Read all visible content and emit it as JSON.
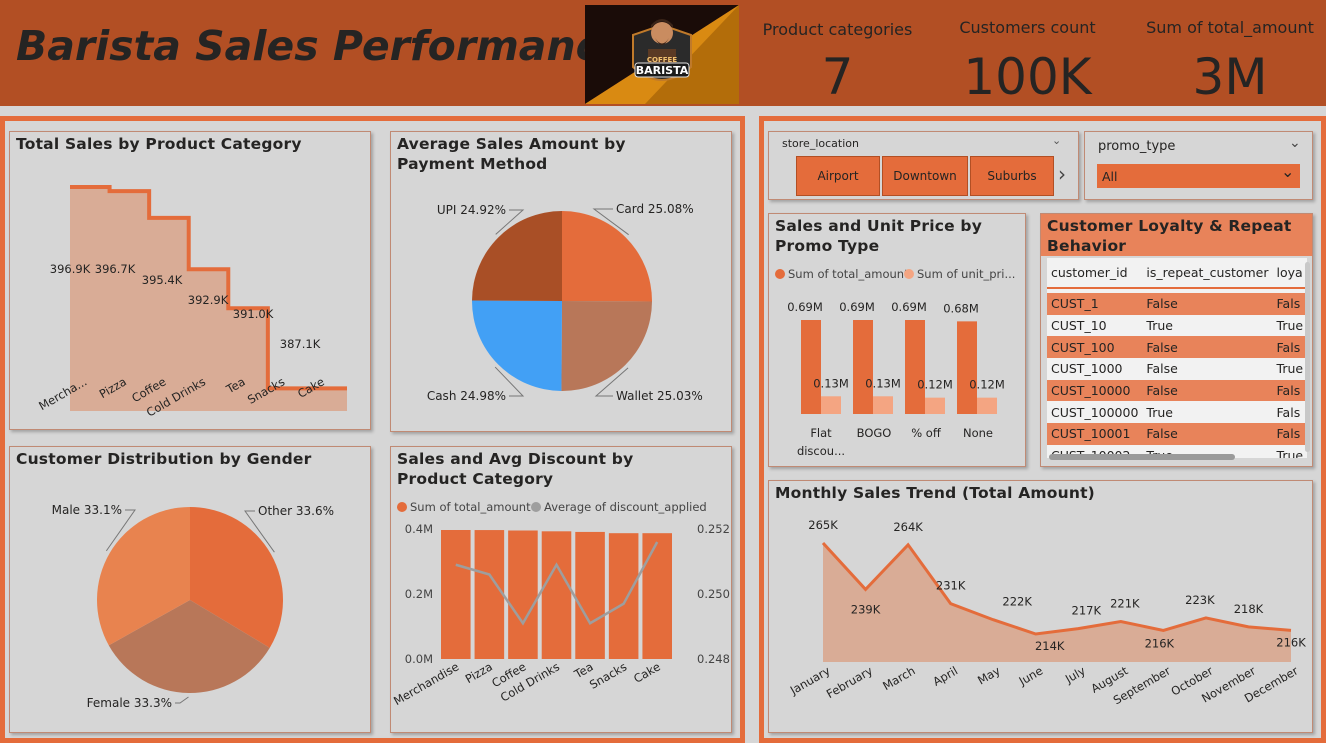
{
  "header": {
    "title": "Barista Sales Performance",
    "logo": {
      "line1": "COFFEE",
      "line2": "BARISTA"
    },
    "kpis": [
      {
        "label": "Product categories",
        "value": "7"
      },
      {
        "label": "Customers count",
        "value": "100K"
      },
      {
        "label": "Sum of total_amount",
        "value": "3M"
      }
    ]
  },
  "colors": {
    "orange": "#e46c3b",
    "header": "#b24f24",
    "light": "#f4a582",
    "brown": "#a94f26",
    "blue": "#42a0f5",
    "tan": "#b87759"
  },
  "panels": {
    "category": {
      "title": "Total Sales by Product Category"
    },
    "payment": {
      "title": "Average Sales Amount by Payment Method"
    },
    "gender": {
      "title": "Customer Distribution by Gender"
    },
    "discount": {
      "title": "Sales and Avg Discount by Product Category"
    },
    "promo": {
      "title": "Sales and Unit Price by Promo Type"
    },
    "loyalty": {
      "title": "Customer Loyalty & Repeat Behavior"
    },
    "monthly": {
      "title": "Monthly Sales Trend (Total Amount)"
    }
  },
  "slicers": {
    "store_location": {
      "label": "store_location",
      "options": [
        "Airport",
        "Downtown",
        "Suburbs"
      ]
    },
    "promo_type": {
      "label": "promo_type",
      "value": "All"
    }
  },
  "loyalty_table": {
    "columns": [
      "customer_id",
      "is_repeat_customer",
      "loya"
    ],
    "rows": [
      [
        "CUST_1",
        "False",
        "Fals"
      ],
      [
        "CUST_10",
        "True",
        "True"
      ],
      [
        "CUST_100",
        "False",
        "Fals"
      ],
      [
        "CUST_1000",
        "False",
        "True"
      ],
      [
        "CUST_10000",
        "False",
        "Fals"
      ],
      [
        "CUST_100000",
        "True",
        "Fals"
      ],
      [
        "CUST_10001",
        "False",
        "Fals"
      ],
      [
        "CUST_10002",
        "True",
        "True"
      ]
    ]
  },
  "chart_data": [
    {
      "id": "category",
      "type": "area",
      "title": "Total Sales by Product Category",
      "categories": [
        "Merchandise",
        "Pizza",
        "Coffee",
        "Cold Drinks",
        "Tea",
        "Snacks",
        "Cake"
      ],
      "tick_labels": [
        "Mercha...",
        "Pizza",
        "Coffee",
        "Cold Drinks",
        "Tea",
        "Snacks",
        "Cake"
      ],
      "values": [
        396900,
        396700,
        395400,
        392900,
        391000,
        387100,
        387100
      ],
      "data_labels": [
        "396.9K",
        "396.7K",
        "395.4K",
        "392.9K",
        "391.0K",
        "387.1K"
      ],
      "step": true
    },
    {
      "id": "payment",
      "type": "pie",
      "title": "Average Sales Amount by Payment Method",
      "slices": [
        {
          "name": "Card",
          "value": 25.08,
          "label": "Card 25.08%",
          "color": "#e46c3b"
        },
        {
          "name": "Wallet",
          "value": 25.03,
          "label": "Wallet 25.03%",
          "color": "#b87759"
        },
        {
          "name": "Cash",
          "value": 24.98,
          "label": "Cash 24.98%",
          "color": "#42a0f5"
        },
        {
          "name": "UPI",
          "value": 24.92,
          "label": "UPI 24.92%",
          "color": "#a94f26"
        }
      ]
    },
    {
      "id": "gender",
      "type": "pie",
      "title": "Customer Distribution by Gender",
      "slices": [
        {
          "name": "Other",
          "value": 33.6,
          "label": "Other 33.6%",
          "color": "#e46c3b"
        },
        {
          "name": "Female",
          "value": 33.3,
          "label": "Female 33.3%",
          "color": "#b87759"
        },
        {
          "name": "Male",
          "value": 33.1,
          "label": "Male 33.1%",
          "color": "#e8834f"
        }
      ]
    },
    {
      "id": "discount",
      "type": "bar",
      "title": "Sales and Avg Discount by Product Category",
      "categories": [
        "Merchandise",
        "Pizza",
        "Coffee",
        "Cold Drinks",
        "Tea",
        "Snacks",
        "Cake"
      ],
      "series": [
        {
          "name": "Sum of total_amount",
          "type": "bar",
          "values": [
            396900,
            396700,
            395400,
            392900,
            391000,
            387100,
            387100
          ],
          "color": "#e46c3b"
        },
        {
          "name": "Average of discount_applied",
          "type": "line",
          "values": [
            0.2509,
            0.2506,
            0.2491,
            0.2509,
            0.2491,
            0.2497,
            0.2516
          ],
          "color": "#9e9e9e"
        }
      ],
      "y_ticks": [
        "0.0M",
        "0.2M",
        "0.4M"
      ],
      "ylim": [
        0,
        400000
      ],
      "y2_ticks": [
        "0.248",
        "0.250",
        "0.252"
      ],
      "y2lim": [
        0.248,
        0.252
      ]
    },
    {
      "id": "promo",
      "type": "bar",
      "title": "Sales and Unit Price by Promo Type",
      "categories": [
        "Flat discou...",
        "BOGO",
        "% off",
        "None"
      ],
      "series": [
        {
          "name": "Sum of total_amount",
          "legend_label": "Sum of total_amount",
          "values": [
            690000,
            690000,
            690000,
            680000
          ],
          "labels": [
            "0.69M",
            "0.69M",
            "0.69M",
            "0.68M"
          ],
          "color": "#e46c3b"
        },
        {
          "name": "Sum of unit_price",
          "legend_label": "Sum of unit_pri...",
          "values": [
            130000,
            130000,
            120000,
            120000
          ],
          "labels": [
            "0.13M",
            "0.13M",
            "0.12M",
            "0.12M"
          ],
          "color": "#f4a582"
        }
      ]
    },
    {
      "id": "monthly",
      "type": "area",
      "title": "Monthly Sales Trend (Total Amount)",
      "categories": [
        "January",
        "February",
        "March",
        "April",
        "May",
        "June",
        "July",
        "August",
        "September",
        "October",
        "November",
        "December"
      ],
      "values": [
        265000,
        239000,
        264000,
        231000,
        222000,
        214000,
        217000,
        221000,
        216000,
        223000,
        218000,
        216000
      ],
      "labels": [
        "265K",
        "239K",
        "264K",
        "231K",
        "222K",
        "214K",
        "217K",
        "221K",
        "216K",
        "223K",
        "218K",
        "216K"
      ]
    }
  ]
}
